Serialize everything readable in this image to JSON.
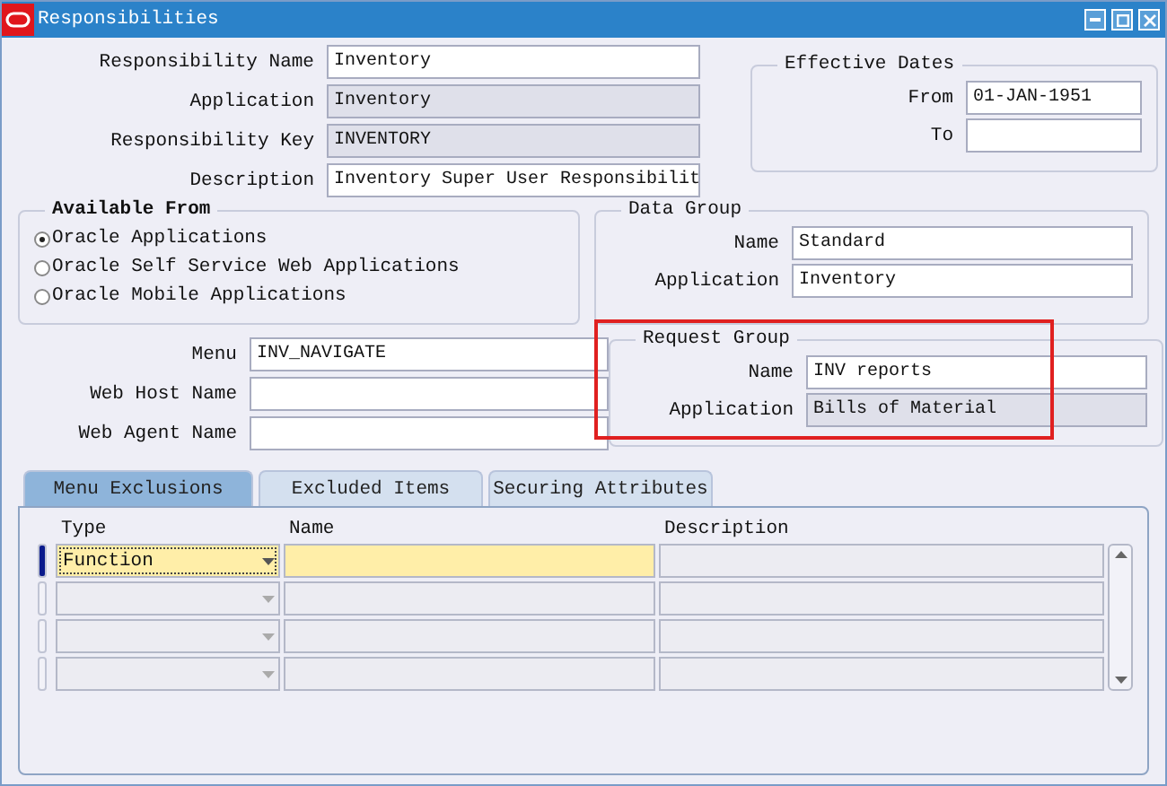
{
  "window": {
    "title": "Responsibilities"
  },
  "main_fields": [
    {
      "label": "Responsibility Name",
      "value": "Inventory",
      "readonly": false
    },
    {
      "label": "Application",
      "value": "Inventory",
      "readonly": true
    },
    {
      "label": "Responsibility Key",
      "value": "INVENTORY",
      "readonly": true
    },
    {
      "label": "Description",
      "value": "Inventory Super User Responsibilit",
      "readonly": false
    }
  ],
  "effective_dates": {
    "title": "Effective Dates",
    "fields": [
      {
        "label": "From",
        "value": "01-JAN-1951",
        "readonly": false
      },
      {
        "label": "To",
        "readonly": false
      }
    ]
  },
  "available_from": {
    "title": "Available From",
    "options": [
      {
        "label": "Oracle Applications",
        "selected": true
      },
      {
        "label": "Oracle Self Service Web Applications",
        "selected": false
      },
      {
        "label": "Oracle Mobile Applications",
        "selected": false
      }
    ]
  },
  "data_group": {
    "title": "Data Group",
    "fields": [
      {
        "label": "Name",
        "value": "Standard",
        "readonly": false
      },
      {
        "label": "Application",
        "value": "Inventory",
        "readonly": false
      }
    ]
  },
  "web_fields": [
    {
      "label": "Menu",
      "value": "INV_NAVIGATE",
      "readonly": false
    },
    {
      "label": "Web Host Name",
      "readonly": false
    },
    {
      "label": "Web Agent Name",
      "readonly": false
    }
  ],
  "request_group": {
    "title": "Request Group",
    "highlighted": true,
    "fields": [
      {
        "label": "Name",
        "value": "INV reports",
        "readonly": false
      },
      {
        "label": "Application",
        "value": "Bills of Material",
        "readonly": true
      }
    ]
  },
  "tabs": [
    {
      "label": "Menu Exclusions",
      "selected": true
    },
    {
      "label": "Excluded Items",
      "selected": false
    },
    {
      "label": "Securing Attributes",
      "selected": false
    }
  ],
  "table": {
    "columns": [
      "Type",
      "Name",
      "Description"
    ],
    "rows": [
      {
        "type": "Function",
        "current": true
      },
      {
        "current": false
      },
      {
        "current": false
      },
      {
        "current": false
      }
    ]
  }
}
